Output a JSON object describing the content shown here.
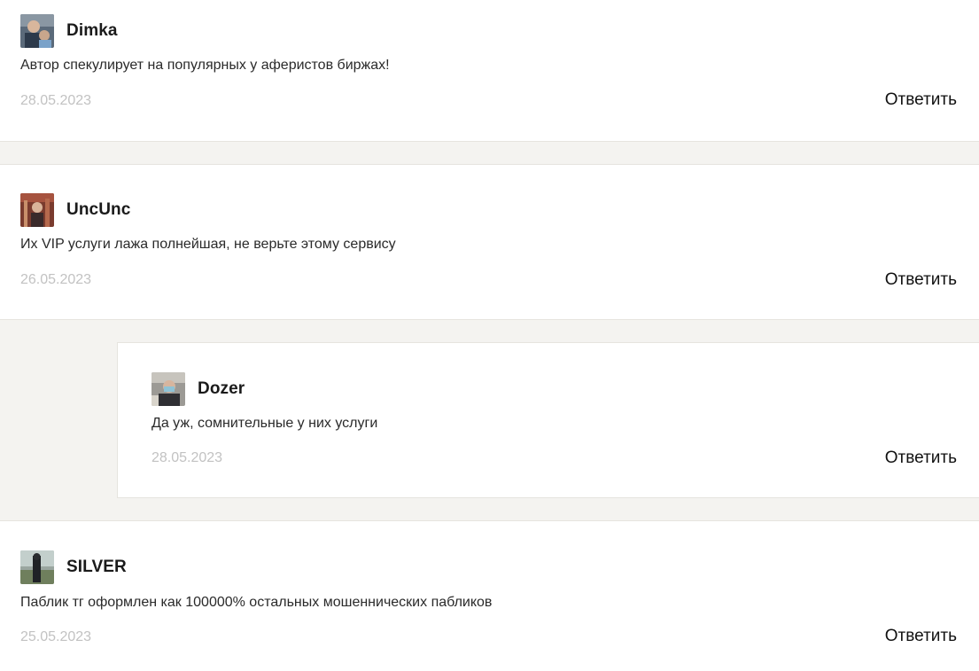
{
  "comments": [
    {
      "author": "Dimka",
      "text": "Автор спекулирует на популярных у аферистов биржах!",
      "date": "28.05.2023",
      "reply_label": "Ответить"
    },
    {
      "author": "UncUnc",
      "text": "Их VIP услуги лажа полнейшая, не верьте этому сервису",
      "date": "26.05.2023",
      "reply_label": "Ответить"
    },
    {
      "author": "Dozer",
      "text": "Да уж, сомнительные у них услуги",
      "date": "28.05.2023",
      "reply_label": "Ответить"
    },
    {
      "author": "SILVER",
      "text": "Паблик тг оформлен как 100000% остальных мошеннических пабликов",
      "date": "25.05.2023",
      "reply_label": "Ответить"
    }
  ],
  "colors": {
    "page_background": "#f4f3f0",
    "card_background": "#ffffff",
    "date_text": "#c2c2c2",
    "author_text": "#1a1a1a"
  }
}
